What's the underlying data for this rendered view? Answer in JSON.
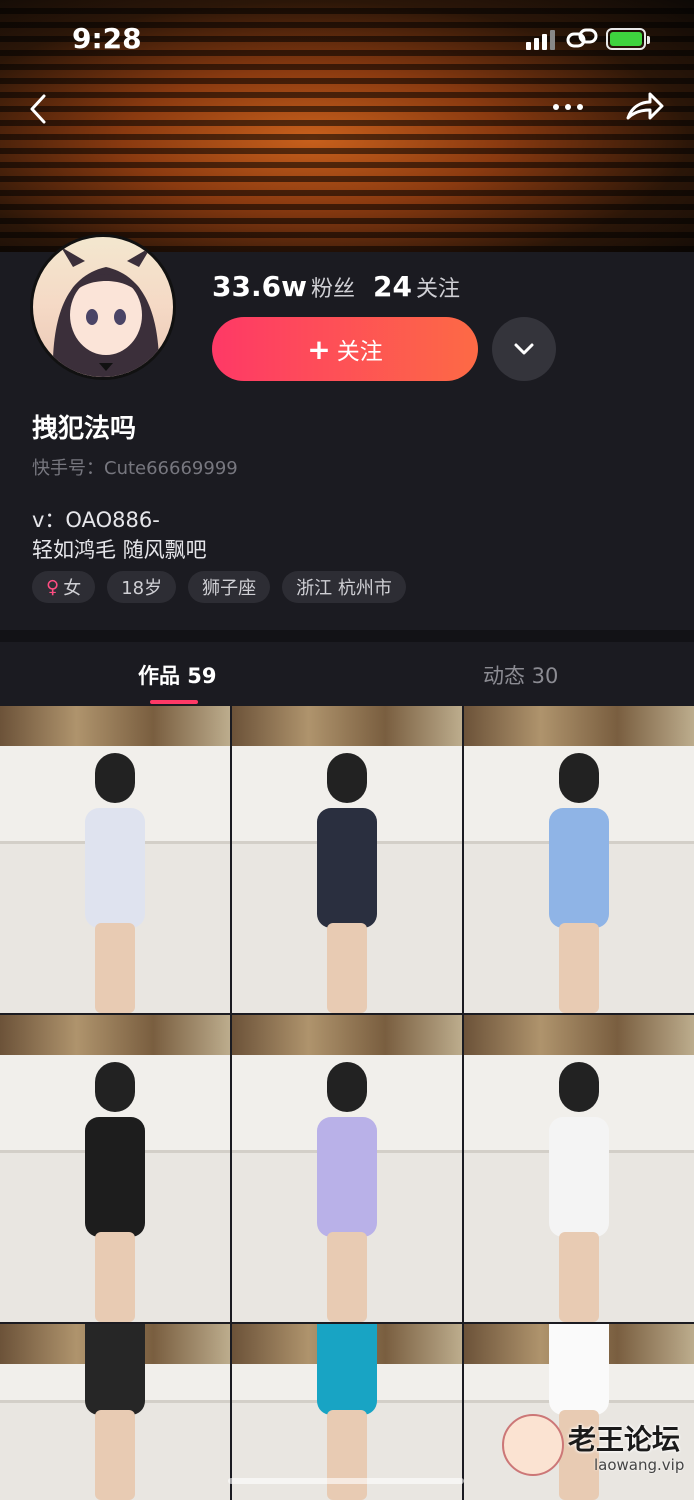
{
  "status_bar": {
    "time": "9:28"
  },
  "profile": {
    "followers_count": "33.6w",
    "followers_label": "粉丝",
    "following_count": "24",
    "following_label": "关注",
    "follow_button_label": "关注",
    "name": "拽犯法吗",
    "uid": "快手号：Cute66669999",
    "bio_line1": "v：OAO886-",
    "bio_line2": "轻如鸿毛 随风飘吧",
    "tags": {
      "gender": "女",
      "age": "18岁",
      "zodiac": "狮子座",
      "location": "浙江 杭州市"
    }
  },
  "tabs": {
    "works_label": "作品 59",
    "moments_label": "动态 30"
  },
  "grid_items": [
    {
      "outfit_color": "#dfe3ef"
    },
    {
      "outfit_color": "#2a2f3f"
    },
    {
      "outfit_color": "#8fb4e6"
    },
    {
      "outfit_color": "#1d1d1d"
    },
    {
      "outfit_color": "#b9b1e8"
    },
    {
      "outfit_color": "#f4f4f4"
    },
    {
      "outfit_color": "#262626"
    },
    {
      "outfit_color": "#18a4c4"
    },
    {
      "outfit_color": "#fafafa"
    }
  ],
  "watermark": {
    "title": "老王论坛",
    "url": "laowang.vip"
  },
  "colors": {
    "accent": "#fe3966",
    "accent_end": "#fd6a45",
    "background": "#1b1b21"
  }
}
